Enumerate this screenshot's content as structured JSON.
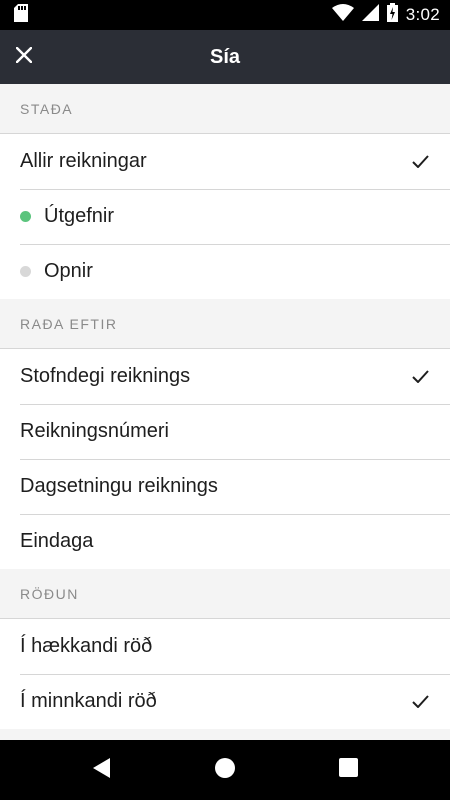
{
  "status_bar": {
    "time": "3:02"
  },
  "app_bar": {
    "title": "Sía"
  },
  "sections": {
    "status": {
      "header": "STAÐA",
      "items": [
        {
          "label": "Allir reikningar",
          "checked": true
        },
        {
          "label": "Útgefnir",
          "dot_color": "#5bc47d"
        },
        {
          "label": "Opnir",
          "dot_color": "#d8d8d8"
        }
      ]
    },
    "sort_by": {
      "header": "RAÐA EFTIR",
      "items": [
        {
          "label": "Stofndegi reiknings",
          "checked": true
        },
        {
          "label": "Reikningsnúmeri"
        },
        {
          "label": "Dagsetningu reiknings"
        },
        {
          "label": "Eindaga"
        }
      ]
    },
    "order": {
      "header": "RÖÐUN",
      "items": [
        {
          "label": "Í hækkandi röð"
        },
        {
          "label": "Í minnkandi röð",
          "checked": true
        }
      ]
    }
  },
  "colors": {
    "app_bar_bg": "#2b2e36",
    "published_dot": "#5bc47d",
    "open_dot": "#d8d8d8"
  }
}
